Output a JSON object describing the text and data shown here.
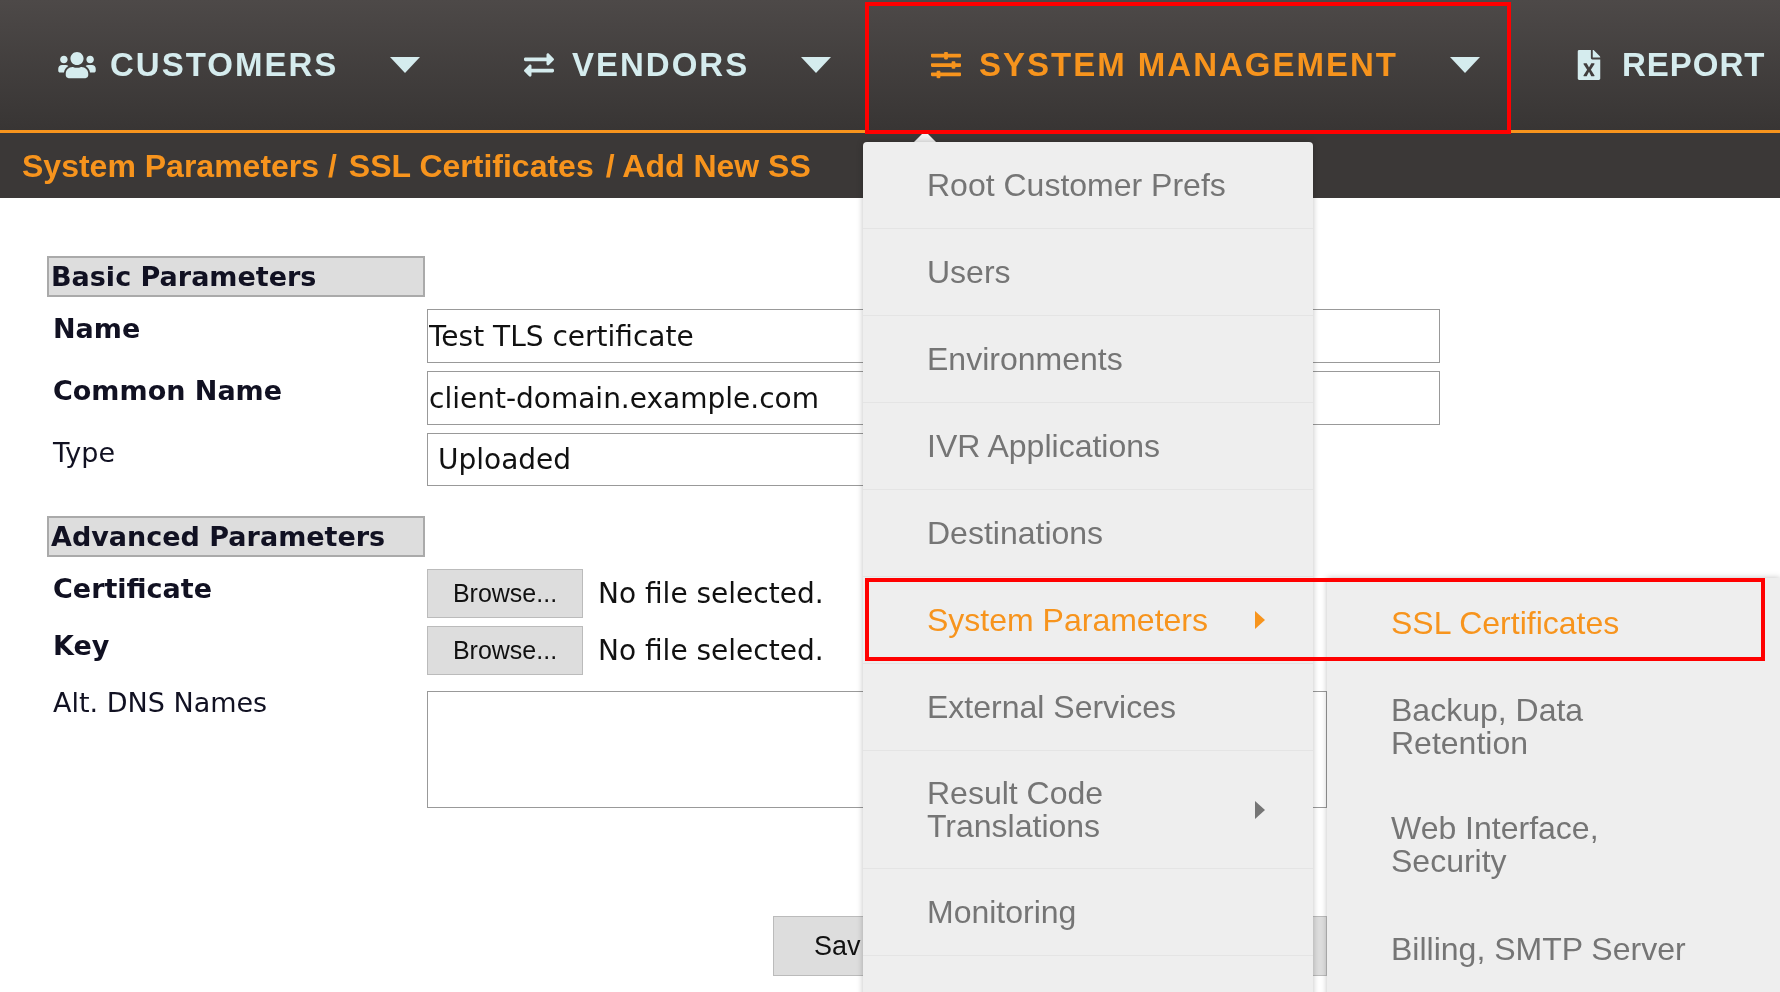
{
  "nav": {
    "items": [
      {
        "label": "CUSTOMERS",
        "selected": false,
        "dropdown": true
      },
      {
        "label": "VENDORS",
        "selected": false,
        "dropdown": true
      },
      {
        "label": "SYSTEM MANAGEMENT",
        "selected": true,
        "dropdown": true
      },
      {
        "label": "REPORT",
        "selected": false
      }
    ]
  },
  "breadcrumb": [
    "System Parameters /",
    "SSL Certificates",
    "/ Add New SS"
  ],
  "form": {
    "sections": [
      {
        "title": "Basic Parameters",
        "fields": [
          {
            "kind": "text",
            "label": "Name",
            "required": true,
            "value": "Test TLS certificate"
          },
          {
            "kind": "text",
            "label": "Common Name",
            "required": true,
            "value": "client-domain.example.com"
          },
          {
            "kind": "select",
            "label": "Type",
            "required": false,
            "value": "Uploaded"
          }
        ]
      },
      {
        "title": "Advanced Parameters",
        "fields": [
          {
            "kind": "file",
            "label": "Certificate",
            "required": true,
            "button": "Browse...",
            "status": "No file selected."
          },
          {
            "kind": "file",
            "label": "Key",
            "required": true,
            "button": "Browse...",
            "status": "No file selected."
          },
          {
            "kind": "textarea",
            "label": "Alt. DNS Names",
            "required": false
          }
        ]
      }
    ],
    "save_button": "Sav"
  },
  "menu": {
    "items": [
      {
        "label": "Root Customer Prefs",
        "selected": false,
        "submenu": false
      },
      {
        "label": "Users",
        "selected": false,
        "submenu": false
      },
      {
        "label": "Environments",
        "selected": false,
        "submenu": false
      },
      {
        "label": "IVR Applications",
        "selected": false,
        "submenu": false
      },
      {
        "label": "Destinations",
        "selected": false,
        "submenu": false
      },
      {
        "label": "System Parameters",
        "selected": true,
        "submenu": true
      },
      {
        "label": "External Services",
        "selected": false,
        "submenu": false
      },
      {
        "label": "Result Code Translations",
        "selected": false,
        "submenu": true
      },
      {
        "label": "Monitoring",
        "selected": false,
        "submenu": false
      }
    ]
  },
  "submenu": {
    "items": [
      {
        "label": "SSL Certificates",
        "selected": true
      },
      {
        "label": "Backup, Data Retention",
        "selected": false
      },
      {
        "label": "Web Interface, Security",
        "selected": false
      },
      {
        "label": "Billing, SMTP Server",
        "selected": false
      }
    ]
  }
}
